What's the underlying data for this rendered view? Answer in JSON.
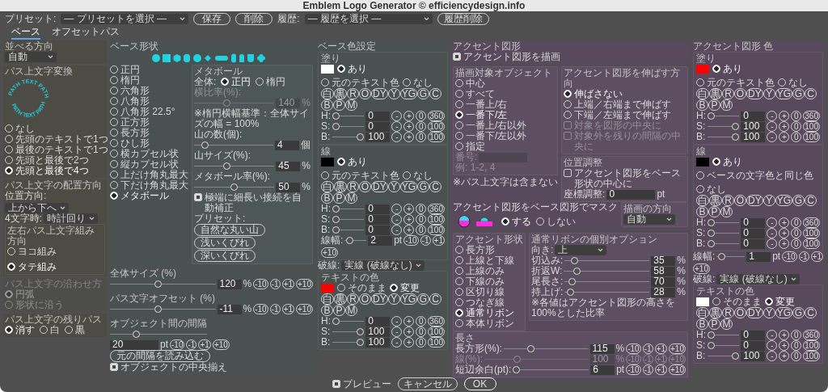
{
  "window": {
    "title": "Emblem Logo Generator © efficiencydesign.info"
  },
  "toolbar": {
    "preset_label": "プリセット:",
    "preset_select": "— プリセットを選択 —",
    "save": "保存",
    "delete": "削除",
    "history_label": "履歴:",
    "history_select": "— 履歴を選択 —",
    "history_delete": "履歴削除"
  },
  "tabs": [
    {
      "label": "ベース",
      "selected": true
    },
    {
      "label": "オフセットパス",
      "selected": false
    }
  ],
  "columns": [
    {
      "items": [
        {
          "kind": "group",
          "title": "並べる方向",
          "items": [
            {
              "kind": "select",
              "value": "自動"
            }
          ]
        },
        {
          "kind": "group",
          "title": "パス上文字変換",
          "items": [
            {
              "kind": "path-text",
              "texts": [
                "PATH TEXT PATH",
                "PATH TEXT PATH"
              ]
            },
            {
              "kind": "radios",
              "items": [
                {
                  "label": "なし",
                  "selected": false
                },
                {
                  "label": "先頭のテキストで1つ",
                  "selected": false
                },
                {
                  "label": "最後のテキストで1つ",
                  "selected": false
                },
                {
                  "label": "先頭と最後で2つ",
                  "selected": false
                },
                {
                  "label": "先頭と最後で4つ",
                  "selected": true
                }
              ]
            }
          ]
        },
        {
          "kind": "group",
          "title": "パス上文字の配置方向",
          "items": [
            {
              "kind": "select",
              "label": "位置方向:",
              "value": "上から下へ"
            },
            {
              "kind": "select",
              "label": "4文字時:",
              "value": "時計回り"
            },
            {
              "kind": "group",
              "title": "左右パス上文字組み方向",
              "items": [
                {
                  "kind": "radio-row",
                  "items": [
                    {
                      "label": "ヨコ組み",
                      "selected": false
                    },
                    {
                      "label": "タテ組み",
                      "selected": true
                    }
                  ]
                }
              ]
            }
          ]
        },
        {
          "kind": "group",
          "title": "パス上文字の沿わせ方",
          "disabled": true,
          "items": [
            {
              "kind": "radios",
              "items": [
                {
                  "label": "円弧",
                  "selected": true
                },
                {
                  "label": "形状に沿う",
                  "selected": false
                }
              ]
            }
          ]
        },
        {
          "kind": "group",
          "title": "パス上文字の残りパス",
          "items": [
            {
              "kind": "radio-row",
              "items": [
                {
                  "label": "消す",
                  "selected": true
                },
                {
                  "label": "白",
                  "selected": false
                },
                {
                  "label": "黒",
                  "selected": false
                }
              ]
            }
          ]
        }
      ]
    },
    {
      "items": [
        {
          "kind": "group",
          "title": "ベース形状",
          "items": [
            {
              "kind": "shapes"
            },
            {
              "kind": "columns",
              "items": [
                {
                  "kind": "radios",
                  "items": [
                    {
                      "label": "正円",
                      "selected": false
                    },
                    {
                      "label": "楕円",
                      "selected": false
                    },
                    {
                      "label": "六角形",
                      "selected": false
                    },
                    {
                      "label": "八角形",
                      "selected": false
                    },
                    {
                      "label": "八角形 22.5°",
                      "selected": false
                    },
                    {
                      "label": "正方形",
                      "selected": false
                    },
                    {
                      "label": "長方形",
                      "selected": false
                    },
                    {
                      "label": "ひし形",
                      "selected": false
                    },
                    {
                      "label": "横カプセル状",
                      "selected": false
                    },
                    {
                      "label": "縦カプセル状",
                      "selected": false
                    },
                    {
                      "label": "上だけ角丸最大",
                      "selected": false
                    },
                    {
                      "label": "下だけ角丸最大",
                      "selected": false
                    },
                    {
                      "label": "メタボール",
                      "selected": true
                    }
                  ]
                },
                {
                  "kind": "group",
                  "title": "メタボール",
                  "items": [
                    {
                      "kind": "radio-row",
                      "label": "全体:",
                      "items": [
                        {
                          "label": "正円",
                          "selected": true
                        },
                        {
                          "label": "楕円",
                          "selected": false
                        }
                      ]
                    },
                    {
                      "kind": "label",
                      "text": "横比率(%):",
                      "disabled": true
                    },
                    {
                      "kind": "slider",
                      "level": 0.4,
                      "value": "140",
                      "unit": "%",
                      "disabled": true
                    },
                    {
                      "kind": "note",
                      "text": "※楕円横幅基準：全体サイズの幅 = 100%"
                    },
                    {
                      "kind": "label",
                      "text": "山の数(個):"
                    },
                    {
                      "kind": "slider",
                      "level": 0.1,
                      "value": "4",
                      "unit": "個"
                    },
                    {
                      "kind": "label",
                      "text": "山サイズ(%):"
                    },
                    {
                      "kind": "slider",
                      "level": 0.4,
                      "value": "45",
                      "unit": "%"
                    },
                    {
                      "kind": "label",
                      "text": "メタボール率(%):"
                    },
                    {
                      "kind": "slider",
                      "level": 0.5,
                      "value": "50",
                      "unit": "%"
                    },
                    {
                      "kind": "check",
                      "label": "極端に細長い接続を自動補正",
                      "checked": true
                    },
                    {
                      "kind": "label",
                      "text": "プリセット:"
                    },
                    {
                      "kind": "buttons",
                      "items": [
                        "自然な丸い山",
                        "浅いくびれ",
                        "深いくびれ"
                      ]
                    }
                  ]
                }
              ]
            }
          ]
        },
        {
          "kind": "group",
          "title": "全体サイズ (%)",
          "items": [
            {
              "kind": "slider",
              "level": 0.45,
              "value": "120",
              "unit": "%",
              "steps": [
                "-10",
                "-1",
                "+1",
                "+10"
              ]
            }
          ]
        },
        {
          "kind": "group",
          "title": "パス文字オフセット (%)",
          "items": [
            {
              "kind": "slider",
              "level": 0.45,
              "value": "-11",
              "unit": "%",
              "steps": [
                "-10",
                "-1",
                "+1",
                "+10"
              ]
            }
          ]
        },
        {
          "kind": "group",
          "title": "オブジェクト間の間隔",
          "items": [
            {
              "kind": "slider",
              "level": 0.25
            },
            {
              "kind": "field",
              "value": "20",
              "unit": "pt",
              "steps": [
                "-10",
                "-1",
                "+1",
                "+10"
              ]
            },
            {
              "kind": "buttons",
              "items": [
                "元の間隔を読み込む"
              ]
            },
            {
              "kind": "check",
              "label": "オブジェクトの中央揃え",
              "checked": true
            }
          ]
        }
      ]
    },
    {
      "items": [
        {
          "kind": "group",
          "title": "ベース色設定",
          "items": [
            {
              "kind": "color",
              "title": "塗り",
              "color": "#ffffff",
              "options": [
                {
                  "label": "あり",
                  "selected": true
                },
                {
                  "label": "元のテキスト色",
                  "selected": false
                },
                {
                  "label": "なし",
                  "selected": false
                }
              ],
              "presets": [
                "白",
                "黒",
                "R",
                "O",
                "DY",
                "Y",
                "YG",
                "G",
                "C",
                "B",
                "P",
                "M"
              ],
              "items": [
                {
                  "kind": "slider",
                  "label": "H:",
                  "level": 0,
                  "value": "0",
                  "steps": [
                    "-",
                    "+",
                    "0",
                    "360"
                  ]
                },
                {
                  "kind": "slider",
                  "label": "S:",
                  "level": 0,
                  "value": "0",
                  "steps": [
                    "-",
                    "+",
                    "0",
                    "100"
                  ]
                },
                {
                  "kind": "slider",
                  "label": "B:",
                  "level": 1,
                  "value": "100",
                  "steps": [
                    "-",
                    "+",
                    "0",
                    "100"
                  ]
                }
              ]
            },
            {
              "kind": "color",
              "title": "線",
              "color": "#000000",
              "options": [
                {
                  "label": "あり",
                  "selected": true
                },
                {
                  "label": "元のテキスト色",
                  "selected": false
                },
                {
                  "label": "なし",
                  "selected": false
                }
              ],
              "presets": [
                "白",
                "黒",
                "R",
                "O",
                "DY",
                "Y",
                "YG",
                "G",
                "C",
                "B",
                "P",
                "M"
              ],
              "items": [
                {
                  "kind": "slider",
                  "label": "H:",
                  "level": 0,
                  "value": "0",
                  "steps": [
                    "-",
                    "+",
                    "0",
                    "360"
                  ]
                },
                {
                  "kind": "slider",
                  "label": "S:",
                  "level": 0,
                  "value": "0",
                  "steps": [
                    "-",
                    "+",
                    "0",
                    "100"
                  ]
                },
                {
                  "kind": "slider",
                  "label": "B:",
                  "level": 0,
                  "value": "0",
                  "steps": [
                    "-",
                    "+",
                    "0",
                    "100"
                  ]
                },
                {
                  "kind": "slider",
                  "label": "線幅:",
                  "level": 0.1,
                  "value": "2",
                  "unit": "pt",
                  "steps": [
                    "-10",
                    "-1",
                    "+1",
                    "+10"
                  ]
                }
              ]
            },
            {
              "kind": "select",
              "label": "破線:",
              "value": "実線 (破線なし)"
            },
            {
              "kind": "color",
              "title": "テキストの色",
              "color": "#ff0000",
              "options": [
                {
                  "label": "そのまま",
                  "selected": false
                },
                {
                  "label": "変更",
                  "selected": true
                }
              ],
              "presets": [
                "白",
                "黒",
                "R",
                "O",
                "DY",
                "Y",
                "YG",
                "G",
                "C",
                "B",
                "P",
                "M"
              ],
              "items": [
                {
                  "kind": "slider",
                  "label": "H:",
                  "level": 0,
                  "value": "0",
                  "steps": [
                    "-",
                    "+",
                    "0",
                    "360"
                  ]
                },
                {
                  "kind": "slider",
                  "label": "S:",
                  "level": 1,
                  "value": "100",
                  "steps": [
                    "-",
                    "+",
                    "0",
                    "100"
                  ]
                },
                {
                  "kind": "slider",
                  "label": "B:",
                  "level": 1,
                  "value": "100",
                  "steps": [
                    "-",
                    "+",
                    "0",
                    "100"
                  ]
                }
              ]
            }
          ]
        }
      ]
    },
    {
      "items": [
        {
          "kind": "group",
          "title": "アクセント図形",
          "items": [
            {
              "kind": "check",
              "label": "アクセント図形を描画",
              "checked": true
            }
          ]
        },
        {
          "kind": "group",
          "items": [
            {
              "kind": "columns",
              "items": [
                {
                  "kind": "stack",
                  "items": [
                    {
                      "kind": "group",
                      "title": "描画対象オブジェクト",
                      "items": [
                        {
                          "kind": "radios",
                          "items": [
                            {
                              "label": "中心",
                              "selected": false
                            },
                            {
                              "label": "すべて",
                              "selected": false
                            },
                            {
                              "label": "一番上/右",
                              "selected": false
                            },
                            {
                              "label": "一番下/左",
                              "selected": true
                            },
                            {
                              "label": "一番上/右以外",
                              "selected": false
                            },
                            {
                              "label": "一番下/左以外",
                              "selected": false
                            },
                            {
                              "label": "指定",
                              "selected": false
                            }
                          ]
                        },
                        {
                          "kind": "field",
                          "label": "番号:",
                          "disabled": true
                        },
                        {
                          "kind": "note",
                          "text": "例: 1-2, 4",
                          "disabled": true
                        }
                      ]
                    },
                    {
                      "kind": "note",
                      "text": "※パス上文字は含まない"
                    }
                  ]
                },
                {
                  "kind": "stack",
                  "items": [
                    {
                      "kind": "group",
                      "title": "アクセント図形を伸ばす方向",
                      "items": [
                        {
                          "kind": "radios",
                          "items": [
                            {
                              "kind": "radio",
                              "label": "伸ばさない",
                              "selected": true,
                              "disabled": false
                            },
                            {
                              "kind": "radio",
                              "label": "上端／右端まで伸ばす",
                              "selected": false,
                              "disabled": false
                            },
                            {
                              "kind": "radio",
                              "label": "下端／左端まで伸ばす",
                              "selected": false,
                              "disabled": false
                            },
                            {
                              "kind": "check",
                              "label": "対象を図形の中央に",
                              "checked": false,
                              "disabled": true
                            },
                            {
                              "kind": "check",
                              "label": "対象外を残りの間隔の中央に",
                              "checked": false,
                              "disabled": true
                            }
                          ]
                        }
                      ]
                    },
                    {
                      "kind": "group",
                      "title": "位置調整",
                      "items": [
                        {
                          "kind": "check",
                          "label": "アクセント図形をベース形状の中心に",
                          "checked": false
                        },
                        {
                          "kind": "field",
                          "label": "座標調整:",
                          "value": "0",
                          "unit": "pt"
                        }
                      ]
                    }
                  ]
                }
              ]
            },
            {
              "kind": "columns",
              "items": [
                {
                  "kind": "stack",
                  "items": [
                    {
                      "kind": "label",
                      "text": "アクセント図形をベース図形でマスク"
                    },
                    {
                      "kind": "columns",
                      "items": [
                        {
                          "kind": "mask-icons"
                        },
                        {
                          "kind": "radio-row",
                          "items": [
                            {
                              "label": "する",
                              "selected": true
                            },
                            {
                              "label": "しない",
                              "selected": false
                            }
                          ]
                        }
                      ]
                    }
                  ]
                },
                {
                  "kind": "group",
                  "title": "描画の方向",
                  "items": [
                    {
                      "kind": "select",
                      "value": "自動"
                    }
                  ]
                }
              ]
            }
          ]
        },
        {
          "kind": "group",
          "items": [
            {
              "kind": "columns",
              "items": [
                {
                  "kind": "group",
                  "title": "アクセント形状",
                  "items": [
                    {
                      "kind": "radios",
                      "items": [
                        {
                          "label": "長方形",
                          "selected": false
                        },
                        {
                          "label": "上線と下線",
                          "selected": false
                        },
                        {
                          "label": "上線のみ",
                          "selected": false
                        },
                        {
                          "label": "下線のみ",
                          "selected": false
                        },
                        {
                          "label": "区切り線",
                          "selected": false
                        },
                        {
                          "label": "つなぎ線",
                          "selected": false
                        },
                        {
                          "label": "通常リボン",
                          "selected": true
                        },
                        {
                          "label": "本体リボン",
                          "selected": false
                        }
                      ]
                    }
                  ]
                },
                {
                  "kind": "group",
                  "title": "通常リボンの個別オプション",
                  "items": [
                    {
                      "kind": "select",
                      "label": "向き:",
                      "value": "上"
                    },
                    {
                      "kind": "slider",
                      "label": "切込み:",
                      "level": 0.08,
                      "value": "35",
                      "unit": "%"
                    },
                    {
                      "kind": "slider",
                      "label": "折返W:",
                      "level": 0.12,
                      "value": "58",
                      "unit": "%"
                    },
                    {
                      "kind": "slider",
                      "label": "尾長さ:",
                      "level": 0.05,
                      "value": "70",
                      "unit": "%"
                    },
                    {
                      "kind": "slider",
                      "label": "持上げ:",
                      "level": 0.03,
                      "value": "28",
                      "unit": "%"
                    },
                    {
                      "kind": "note",
                      "text": "※各値はアクセント図形の高さを100%とした比率"
                    }
                  ]
                }
              ]
            },
            {
              "kind": "group",
              "title": "長さ",
              "items": [
                {
                  "kind": "slider",
                  "label": "長方形(%):",
                  "level": 0.3,
                  "value": "115",
                  "unit": "%",
                  "steps": [
                    "-10",
                    "-1",
                    "+1",
                    "+10"
                  ],
                  "disabled": false
                },
                {
                  "kind": "slider",
                  "label": "線(%):",
                  "level": 0.3,
                  "value": "100",
                  "unit": "%",
                  "steps": [
                    "-10",
                    "-1",
                    "+1",
                    "+10"
                  ],
                  "disabled": true
                },
                {
                  "kind": "slider",
                  "label": "短辺余白(pt):",
                  "level": 0,
                  "value": "6",
                  "unit": "pt",
                  "steps": [
                    "-10",
                    "-1",
                    "+1",
                    "+10"
                  ],
                  "disabled": false
                }
              ]
            }
          ]
        }
      ]
    },
    {
      "items": [
        {
          "kind": "group",
          "title": "アクセント図形 色",
          "items": [
            {
              "kind": "color",
              "title": "塗り",
              "color": "#ff0000",
              "options": [
                {
                  "label": "あり",
                  "selected": true
                },
                {
                  "label": "元のテキスト色",
                  "selected": false
                },
                {
                  "label": "なし",
                  "selected": false
                }
              ],
              "presets": [
                "白",
                "黒",
                "R",
                "O",
                "DY",
                "Y",
                "YG",
                "G",
                "C",
                "B",
                "P",
                "M"
              ],
              "items": [
                {
                  "kind": "slider",
                  "label": "H:",
                  "level": 0,
                  "value": "0",
                  "steps": [
                    "-",
                    "+",
                    "0",
                    "360"
                  ]
                },
                {
                  "kind": "slider",
                  "label": "S:",
                  "level": 1,
                  "value": "100",
                  "steps": [
                    "-",
                    "+",
                    "0",
                    "100"
                  ]
                },
                {
                  "kind": "slider",
                  "label": "B:",
                  "level": 1,
                  "value": "100",
                  "steps": [
                    "-",
                    "+",
                    "0",
                    "100"
                  ]
                }
              ]
            },
            {
              "kind": "color",
              "title": "線",
              "color": "#000000",
              "options": [
                {
                  "label": "あり",
                  "selected": true
                },
                {
                  "label": "ベースの文字色と同じ色",
                  "selected": false
                },
                {
                  "label": "なし",
                  "selected": false
                }
              ],
              "presets": [
                "白",
                "黒",
                "R",
                "O",
                "DY",
                "Y",
                "YG",
                "G",
                "C",
                "B",
                "P",
                "M"
              ],
              "items": [
                {
                  "kind": "slider",
                  "label": "H:",
                  "level": 0,
                  "value": "0",
                  "steps": [
                    "-",
                    "+",
                    "0",
                    "360"
                  ]
                },
                {
                  "kind": "slider",
                  "label": "S:",
                  "level": 0,
                  "value": "0",
                  "steps": [
                    "-",
                    "+",
                    "0",
                    "100"
                  ]
                },
                {
                  "kind": "slider",
                  "label": "B:",
                  "level": 0,
                  "value": "0",
                  "steps": [
                    "-",
                    "+",
                    "0",
                    "100"
                  ]
                }
              ]
            },
            {
              "kind": "slider",
              "label": "線幅:",
              "level": 0.05,
              "value": "1",
              "unit": "pt",
              "steps": [
                "-10",
                "-1",
                "+1",
                "+10"
              ]
            },
            {
              "kind": "select",
              "label": "破線:",
              "value": "実線 (破線なし)"
            },
            {
              "kind": "color",
              "title": "テキストの色",
              "color": "#ffffff",
              "options": [
                {
                  "label": "そのまま",
                  "selected": false
                },
                {
                  "label": "変更",
                  "selected": true
                }
              ],
              "presets": [
                "白",
                "黒",
                "R",
                "O",
                "DY",
                "Y",
                "YG",
                "G",
                "C",
                "B",
                "P",
                "M"
              ],
              "items": [
                {
                  "kind": "slider",
                  "label": "H:",
                  "level": 0,
                  "value": "0",
                  "steps": [
                    "-",
                    "+",
                    "0",
                    "360"
                  ]
                },
                {
                  "kind": "slider",
                  "label": "S:",
                  "level": 0,
                  "value": "0",
                  "steps": [
                    "-",
                    "+",
                    "0",
                    "100"
                  ]
                },
                {
                  "kind": "slider",
                  "label": "B:",
                  "level": 1,
                  "value": "100",
                  "steps": [
                    "-",
                    "+",
                    "0",
                    "100"
                  ]
                }
              ]
            }
          ]
        }
      ]
    }
  ],
  "footer": {
    "preview": {
      "label": "プレビュー",
      "checked": true
    },
    "buttons": [
      {
        "label": "キャンセル",
        "kind": "cancel"
      },
      {
        "label": "OK",
        "kind": "default"
      }
    ]
  }
}
